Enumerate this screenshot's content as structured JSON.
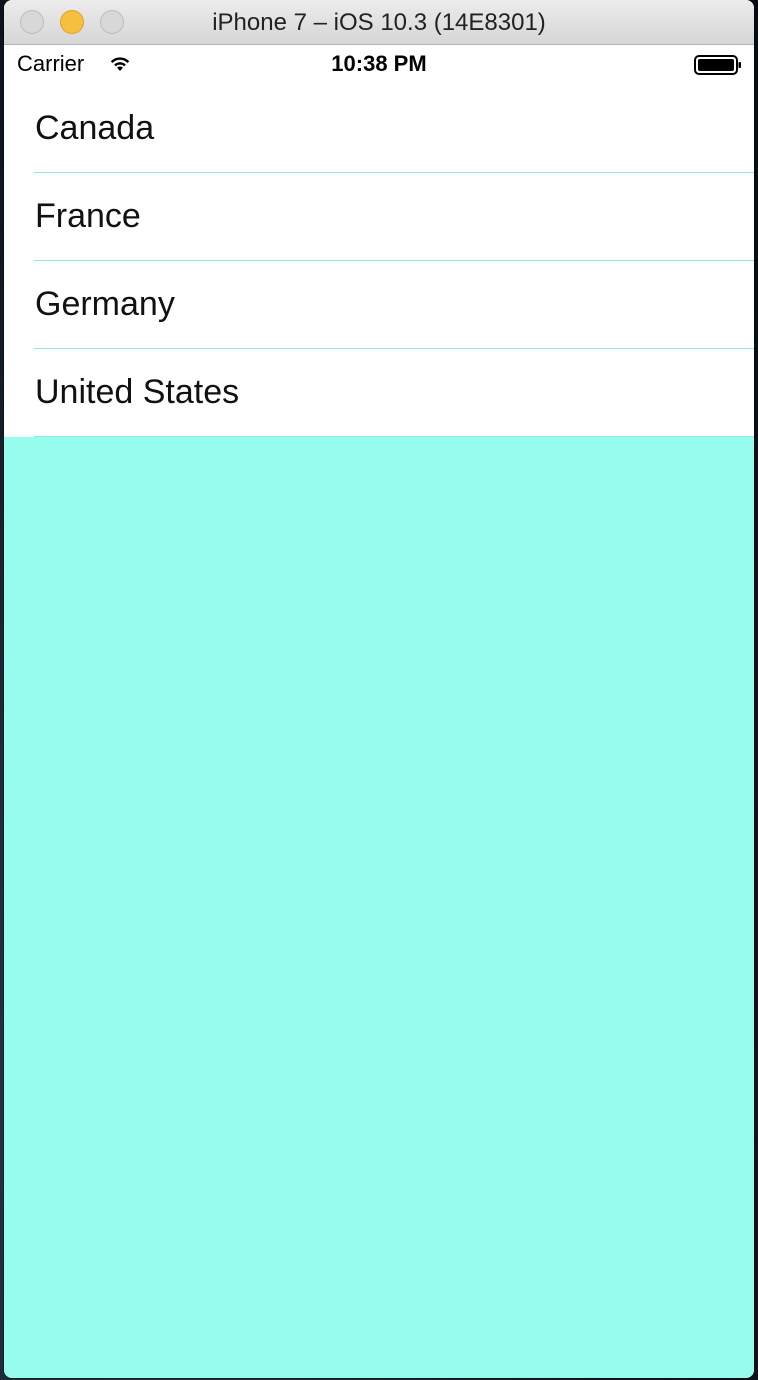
{
  "window": {
    "title": "iPhone 7 – iOS 10.3 (14E8301)"
  },
  "status_bar": {
    "carrier": "Carrier",
    "time": "10:38 PM",
    "wifi_icon": "wifi-icon",
    "battery_icon": "battery-icon"
  },
  "table": {
    "rows": [
      {
        "label": "Canada"
      },
      {
        "label": "France"
      },
      {
        "label": "Germany"
      },
      {
        "label": "United States"
      }
    ]
  },
  "colors": {
    "background": "#96fcee",
    "separator": "#8fe8e4",
    "minimize_button": "#f6bf3e"
  }
}
